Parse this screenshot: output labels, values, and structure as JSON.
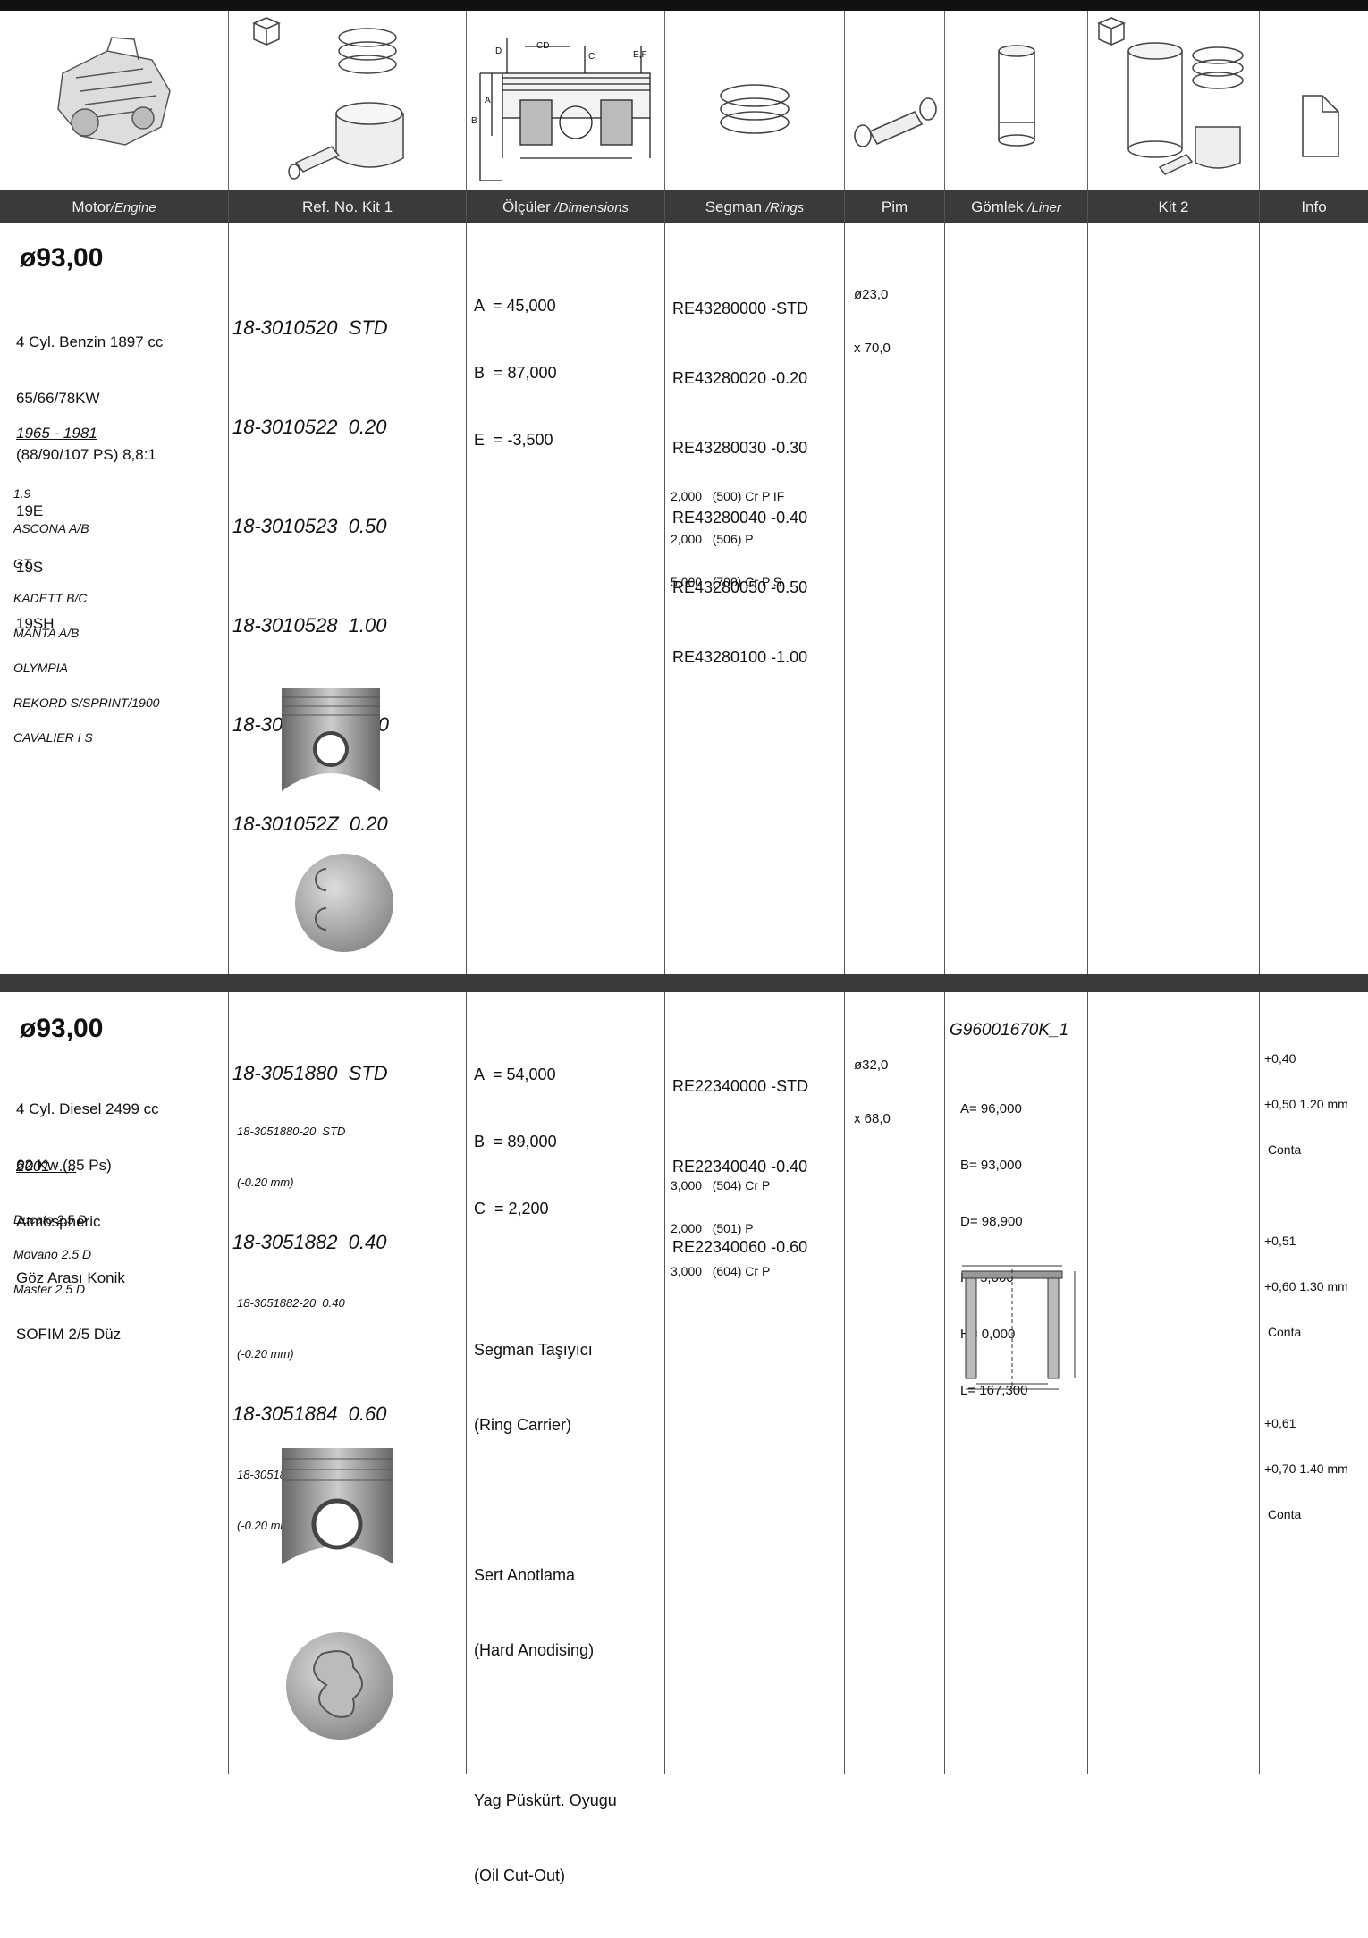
{
  "header": {
    "motor": "Motor",
    "motor_en": "/Engine",
    "ref": "Ref. No. Kit 1",
    "dim": "Ölçüler ",
    "dim_en": "/Dimensions",
    "seg": "Segman ",
    "seg_en": "/Rings",
    "pim": "Pim",
    "liner": "Gömlek ",
    "liner_en": "/Liner",
    "kit2": "Kit 2",
    "info": "Info"
  },
  "diagram_labels": {
    "d": "D",
    "cd": "CD",
    "c": "C",
    "ef": "E,F",
    "a": "A",
    "b": "B"
  },
  "entry1": {
    "diameter": "ø93,00",
    "desc": [
      "4 Cyl. Benzin 1897 cc",
      "65/66/78KW",
      "(88/90/107 PS) 8,8:1",
      "19E",
      "19S",
      "19SH"
    ],
    "years": "1965 - 1981",
    "models": [
      "1.9",
      "ASCONA A/B",
      "GT",
      "KADETT B/C",
      "MANTA A/B",
      "OLYMPIA",
      "REKORD S/SPRINT/1900",
      "CAVALIER I S"
    ],
    "refs": [
      "18-3010520  STD",
      "18-3010522  0.20",
      "18-3010523  0.50",
      "18-3010528  1.00",
      "18-301052X  0.30",
      "18-301052Z  0.20"
    ],
    "dims": [
      "A  = 45,000",
      "B  = 87,000",
      "E  = -3,500"
    ],
    "rings": [
      "RE43280000 -STD",
      "RE43280020 -0.20",
      "RE43280030 -0.30",
      "RE43280040 -0.40",
      "RE43280050 -0.50",
      "RE43280100 -1.00"
    ],
    "ring_specs": [
      "2,000   (500) Cr P IF",
      "2,000   (506) P",
      "5,000   (700) Cr P S"
    ],
    "pin": [
      "ø23,0",
      "x 70,0"
    ]
  },
  "entry2": {
    "diameter": "ø93,00",
    "desc": [
      "4 Cyl. Diesel 2499 cc",
      "62 Kw (85 Ps)",
      "Atmospheric",
      "Göz Arası Konik",
      "SOFIM 2/5 Düz"
    ],
    "years": "2001 -....",
    "models": [
      "Ducato 2.5 D",
      "Movano 2.5 D",
      "Master 2.5 D"
    ],
    "refs": [
      {
        "main": "18-3051880  STD",
        "sub1": "18-3051880-20  STD",
        "sub2": "(-0.20 mm)"
      },
      {
        "main": "18-3051882  0.40",
        "sub1": "18-3051882-20  0.40",
        "sub2": "(-0.20 mm)"
      },
      {
        "main": "18-3051884  0.60",
        "sub1": "18-3051884-20  0.60",
        "sub2": "(-0.20 mm)"
      }
    ],
    "dims": [
      "A  = 54,000",
      "B  = 89,000",
      "C  = 2,200"
    ],
    "features": [
      "Segman Taşıyıcı",
      "(Ring Carrier)",
      "Sert Anotlama",
      "(Hard Anodising)",
      "Yag Püskürt. Oyugu",
      "(Oil Cut-Out)"
    ],
    "rings": [
      "RE22340000 -STD",
      "RE22340040 -0.40",
      "RE22340060 -0.60"
    ],
    "ring_specs": [
      "3,000   (504) Cr P",
      "2,000   (501) P",
      "3,000   (604) Cr P"
    ],
    "pin": [
      "ø32,0",
      "x 68,0"
    ],
    "liner_ref": "G96001670K_1",
    "liner_dims": [
      "A= 96,000",
      "B= 93,000",
      "D= 98,900",
      "F= 5,000",
      "H= 0,000",
      "L= 167,300"
    ],
    "info": [
      "+0,40",
      "+0,50 1.20 mm",
      " Conta",
      "+0,51",
      "+0,60 1.30 mm",
      " Conta",
      "+0,61",
      "+0,70 1.40 mm",
      " Conta"
    ]
  }
}
